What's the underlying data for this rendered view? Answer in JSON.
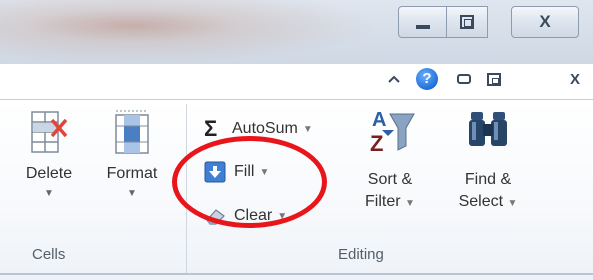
{
  "window": {
    "minimize_icon": "minimize-icon",
    "maximize_icon": "restore-icon",
    "close_glyph": "X"
  },
  "ribbon_controls": {
    "collapse_glyph": "^",
    "help_glyph": "?",
    "minimize_icon": "ribbon-minimize-icon",
    "restore_icon": "ribbon-restore-icon",
    "close_glyph": "X"
  },
  "groups": {
    "cells": {
      "label": "Cells",
      "delete": {
        "label": "Delete",
        "icon": "delete-cells-icon"
      },
      "format": {
        "label": "Format",
        "icon": "format-cells-icon"
      }
    },
    "editing": {
      "label": "Editing",
      "autosum": {
        "label": "AutoSum",
        "glyph": "Σ"
      },
      "fill": {
        "label": "Fill",
        "icon": "fill-down-icon"
      },
      "clear": {
        "label": "Clear",
        "icon": "eraser-icon"
      },
      "sort": {
        "label_line1": "Sort &",
        "label_line2": "Filter",
        "icon": "sort-filter-icon"
      },
      "find": {
        "label_line1": "Find &",
        "label_line2": "Select",
        "icon": "binoculars-icon"
      }
    }
  },
  "annotation": {
    "shape": "circle",
    "color": "#e8161b",
    "target": "Fill"
  },
  "colors": {
    "accent_blue": "#1e6fd9",
    "annotation_red": "#e8161b"
  }
}
